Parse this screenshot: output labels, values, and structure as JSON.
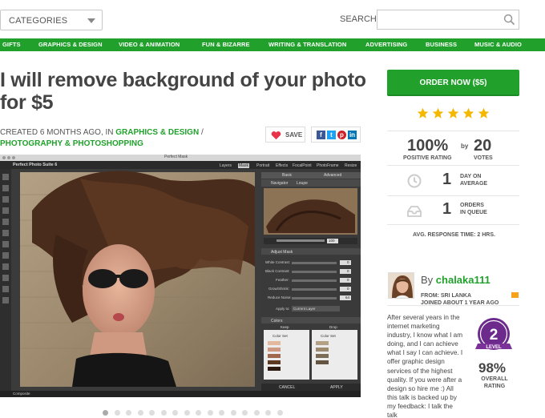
{
  "header": {
    "categories_label": "CATEGORIES",
    "search_label": "SEARCH",
    "search_placeholder": ""
  },
  "nav": {
    "items": [
      "GIFTS",
      "GRAPHICS & DESIGN",
      "VIDEO & ANIMATION",
      "FUN & BIZARRE",
      "WRITING & TRANSLATION",
      "ADVERTISING",
      "BUSINESS",
      "MUSIC & AUDIO"
    ]
  },
  "gig": {
    "title": "I will remove background of your photo for $5",
    "created": "CREATED 6 MONTHS AGO, IN ",
    "category": "GRAPHICS & DESIGN",
    "separator": " / ",
    "subcategory": "PHOTOGRAPHY & PHOTOSHOPPING",
    "save_label": "SAVE"
  },
  "screenshot": {
    "app_title": "Perfect Mask",
    "suite_name": "Perfect Photo Suite 6",
    "top_tabs": [
      "Layers",
      "Mask",
      "Portrait",
      "Effects",
      "FocalPoint",
      "PhotoFrame",
      "Resize"
    ],
    "mode_tabs": [
      "Basic",
      "Advanced"
    ],
    "navigator_label": "Navigator",
    "loupe_label": "Loupe",
    "zoom_value": "100",
    "adjust_mask_label": "Adjust Mask",
    "sliders": [
      {
        "label": "White Contrast:",
        "value": "0"
      },
      {
        "label": "Black Contrast:",
        "value": "0"
      },
      {
        "label": "Feather:",
        "value": "0"
      },
      {
        "label": "Grow/Shrink:",
        "value": "0"
      },
      {
        "label": "Reduce Noise:",
        "value": "64"
      }
    ],
    "apply_to_label": "Apply to:",
    "apply_to_value": "Current Layer",
    "colors_label": "Colors",
    "keep_label": "Keep",
    "drop_label": "Drop",
    "color_set_label": "Color Set",
    "cancel_label": "CANCEL",
    "apply_label": "APPLY",
    "composite_label": "Composite"
  },
  "sidebar": {
    "order_label": "ORDER NOW ($5)",
    "rating_stars": 5,
    "positive_pct": "100%",
    "positive_label": "POSITIVE RATING",
    "by_label": "by",
    "votes": "20",
    "votes_label": "VOTES",
    "days": "1",
    "days_label_1": "DAY ON",
    "days_label_2": "AVERAGE",
    "orders": "1",
    "orders_label_1": "ORDERS",
    "orders_label_2": "IN QUEUE",
    "response_time": "AVG. RESPONSE TIME: 2 HRS.",
    "seller_by": "By ",
    "seller_name": "chalaka111",
    "from": "FROM: SRI LANKA",
    "joined": "JOINED ABOUT 1 YEAR AGO",
    "bio": "After several years in the internet marketing industry, I know what I am doing, and I can achieve what I say I can achieve. I offer graphic design services of the highest quality. If you were after a design so hire me :) All this talk is backed up by my feedback: I talk the talk",
    "level_number": "2",
    "level_label": "LEVEL",
    "overall_pct": "98%",
    "overall_label_1": "OVERALL",
    "overall_label_2": "RATING"
  },
  "carousel": {
    "count": 16,
    "active": 0
  },
  "colors": {
    "brand_green": "#21a12c",
    "star": "#f5b800",
    "badge_purple": "#6b2a8c"
  }
}
